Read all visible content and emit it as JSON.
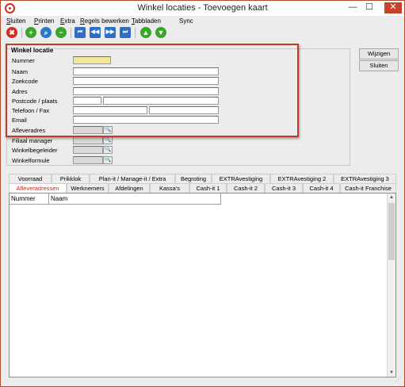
{
  "window": {
    "title": "Winkel locaties - Toevoegen kaart",
    "min_glyph": "—",
    "max_glyph": "☐",
    "close_glyph": "✕"
  },
  "menu": [
    {
      "label": "Sluiten",
      "underline": "S",
      "rest": "luiten"
    },
    {
      "label": "Printen",
      "underline": "P",
      "rest": "rinten"
    },
    {
      "label": "Extra",
      "underline": "E",
      "rest": "xtra"
    },
    {
      "label": "Regels bewerken",
      "underline": "R",
      "rest": "egels bewerken"
    },
    {
      "label": "Tabbladen",
      "underline": "T",
      "rest": "abbladen"
    },
    {
      "label": "Sync",
      "underline": "",
      "rest": "Sync"
    }
  ],
  "toolbar": {
    "delete_icon": "✖",
    "add_icon": "+",
    "search_icon": "⌕",
    "remove_icon": "−",
    "first_icon": "⏮",
    "prev_icon": "◀◀",
    "next_icon": "▶▶",
    "last_icon": "⏭",
    "up_icon": "▲",
    "down_icon": "▼"
  },
  "group": {
    "title": "Winkel locatie",
    "labels": {
      "nummer": "Nummer",
      "naam": "Naam",
      "zoekcode": "Zoekcode",
      "adres": "Adres",
      "postcode": "Postcode / plaats",
      "telefoon": "Telefoon / Fax",
      "email": "Email",
      "afleveradres": "Afleveradres",
      "filiaal": "Filiaal manager",
      "winkelbegeleider": "Winkelbegeleider",
      "winkelformule": "Winkelformule"
    },
    "values": {
      "nummer": "",
      "naam": "",
      "zoekcode": "",
      "adres": "",
      "postcode": "",
      "plaats": "",
      "telefoon": "",
      "fax": "",
      "email": "",
      "afleveradres": "",
      "filiaal": "",
      "winkelbegeleider": "",
      "winkelformule": ""
    },
    "pick_glyph": "🔍"
  },
  "buttons": {
    "wijzigen": "Wijzigen",
    "sluiten": "Sluiten"
  },
  "tabs_row1": [
    "Voorraad",
    "Prikklok",
    "Plan-it / Manage-it / Extra",
    "Begroting",
    "EXTRAvestiging",
    "EXTRAvestiging 2",
    "EXTRAvestiging 3"
  ],
  "tabs_row2": [
    "Afleveradressen",
    "Werknemers",
    "Afdelingen",
    "Kassa's",
    "Cash-it 1",
    "Cash-it 2",
    "Cash-it 3",
    "Cash-it 4",
    "Cash-it Franchise"
  ],
  "grid": {
    "columns": [
      "Nummer",
      "Naam"
    ],
    "rows": []
  }
}
